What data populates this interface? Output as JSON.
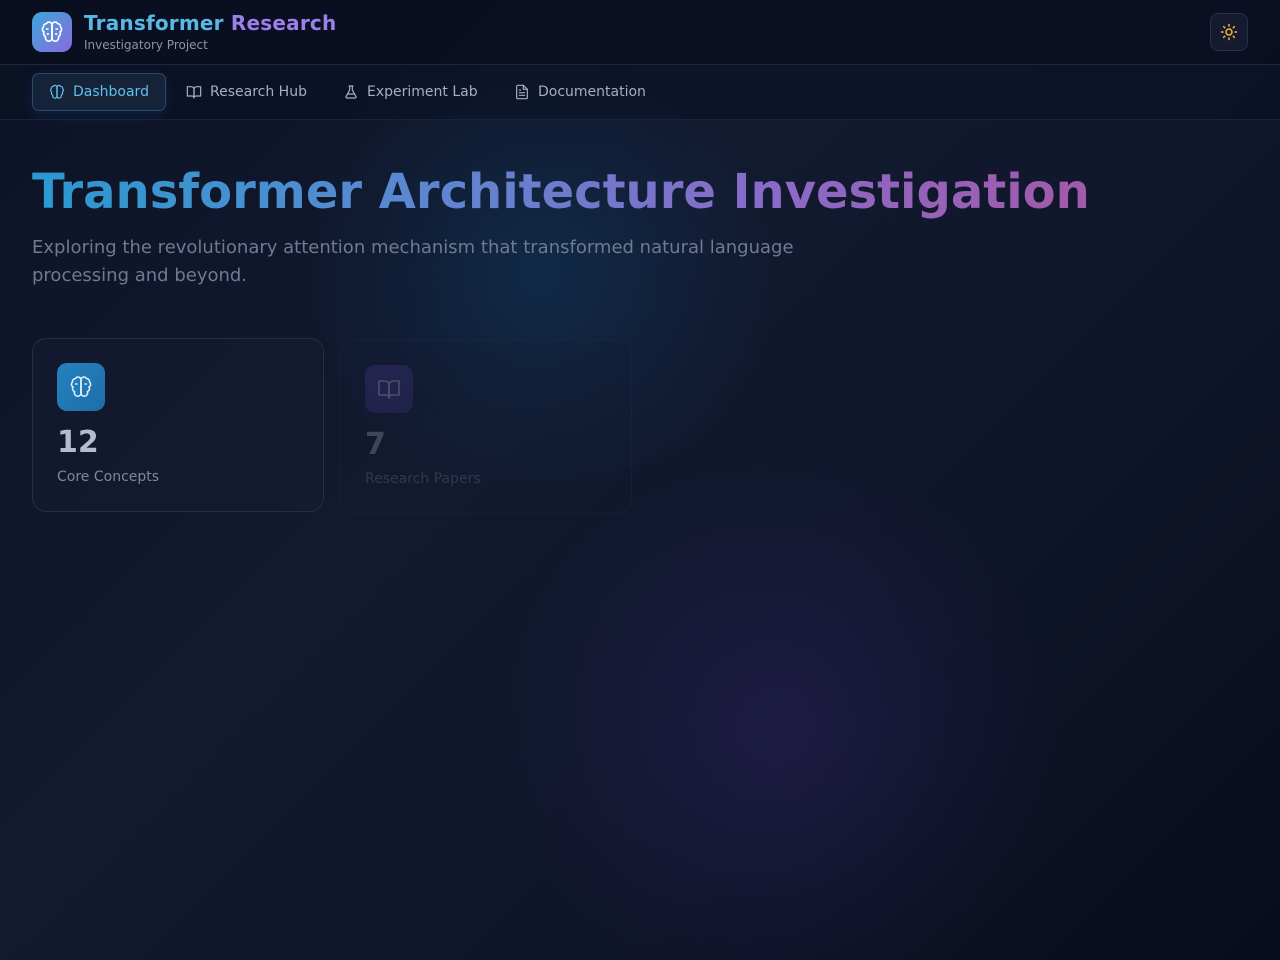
{
  "header": {
    "brand_title_part1": "Transformer",
    "brand_title_part2": "Research",
    "brand_subtitle": "Investigatory Project",
    "logo_icon": "brain-icon",
    "theme_toggle_icon": "sun-icon"
  },
  "nav": {
    "items": [
      {
        "label": "Dashboard",
        "icon": "brain-icon",
        "active": true
      },
      {
        "label": "Research Hub",
        "icon": "book-open-icon",
        "active": false
      },
      {
        "label": "Experiment Lab",
        "icon": "flask-icon",
        "active": false
      },
      {
        "label": "Documentation",
        "icon": "document-icon",
        "active": false
      }
    ]
  },
  "hero": {
    "title": "Transformer Architecture Investigation",
    "subtitle": "Exploring the revolutionary attention mechanism that transformed natural language processing and beyond."
  },
  "stats": [
    {
      "value": "12",
      "label": "Core Concepts",
      "icon": "brain-icon"
    },
    {
      "value": "7",
      "label": "Research Papers",
      "icon": "book-open-icon"
    }
  ],
  "colors": {
    "accent_cyan": "#5ec0ee",
    "accent_purple": "#9a80e8",
    "theme_sun": "#f5b731",
    "background": "#0d1326"
  }
}
